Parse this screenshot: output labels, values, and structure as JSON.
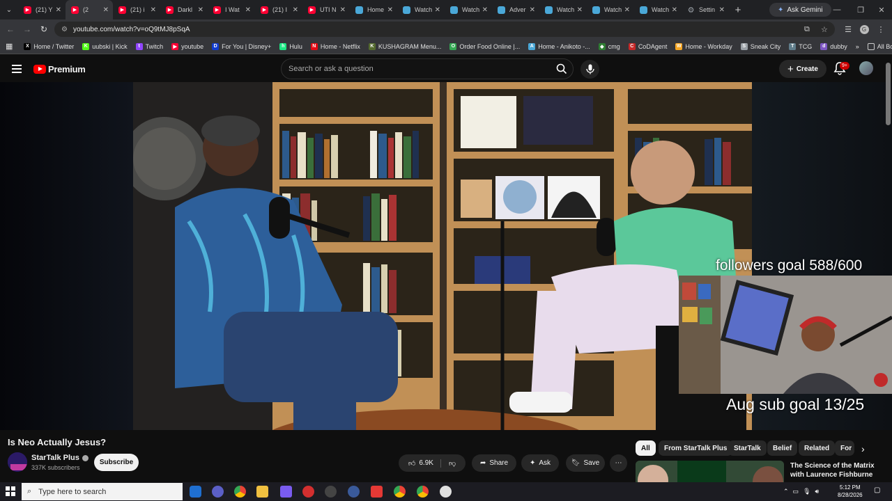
{
  "browser": {
    "tabs": [
      {
        "title": "(21) Y",
        "icon": "youtube-icon",
        "color": "#ff0033"
      },
      {
        "title": "(2",
        "icon": "youtube-icon",
        "color": "#ff0033",
        "active": true
      },
      {
        "title": "(21) i",
        "icon": "youtube-icon",
        "color": "#ff0033"
      },
      {
        "title": "Darkl",
        "icon": "youtube-icon",
        "color": "#ff0033"
      },
      {
        "title": "I Wat",
        "icon": "youtube-icon",
        "color": "#ff0033"
      },
      {
        "title": "(21) I",
        "icon": "youtube-icon",
        "color": "#ff0033"
      },
      {
        "title": "UTI N",
        "icon": "youtube-icon",
        "color": "#ff0033"
      },
      {
        "title": "Home",
        "icon": "globe-icon",
        "color": "#4aa8d8"
      },
      {
        "title": "Watch",
        "icon": "globe-icon",
        "color": "#4aa8d8"
      },
      {
        "title": "Watch",
        "icon": "globe-icon",
        "color": "#4aa8d8"
      },
      {
        "title": "Adver",
        "icon": "globe-icon",
        "color": "#4aa8d8"
      },
      {
        "title": "Watch",
        "icon": "globe-icon",
        "color": "#4aa8d8"
      },
      {
        "title": "Watch",
        "icon": "globe-icon",
        "color": "#4aa8d8"
      },
      {
        "title": "Watch",
        "icon": "globe-icon",
        "color": "#4aa8d8"
      },
      {
        "title": "Settin",
        "icon": "gear-icon",
        "color": "#9aa0a6"
      }
    ],
    "gemini_label": "Ask Gemini",
    "url": "youtube.com/watch?v=oQ9tMJ8pSqA",
    "profile_initial": "G",
    "bookmarks": [
      {
        "label": "Home / Twitter",
        "icon": "x-icon",
        "color": "#000000",
        "glyph": "X"
      },
      {
        "label": "uubski | Kick",
        "icon": "kick-icon",
        "color": "#53fc18",
        "glyph": "K"
      },
      {
        "label": "Twitch",
        "icon": "twitch-icon",
        "color": "#9146ff",
        "glyph": "t"
      },
      {
        "label": "youtube",
        "icon": "youtube-icon",
        "color": "#ff0033",
        "glyph": "▶"
      },
      {
        "label": "For You | Disney+",
        "icon": "disney-icon",
        "color": "#113ccf",
        "glyph": "D"
      },
      {
        "label": "Hulu",
        "icon": "hulu-icon",
        "color": "#1ce783",
        "glyph": "h"
      },
      {
        "label": "Home - Netflix",
        "icon": "netflix-icon",
        "color": "#e50914",
        "glyph": "N"
      },
      {
        "label": "KUSHAGRAM Menu...",
        "icon": "kushagram-icon",
        "color": "#556b2f",
        "glyph": "K"
      },
      {
        "label": "Order Food Online |...",
        "icon": "food-icon",
        "color": "#34a853",
        "glyph": "O"
      },
      {
        "label": "Home - Anikoto -...",
        "icon": "globe-icon",
        "color": "#4aa8d8",
        "glyph": "A"
      },
      {
        "label": "cmg",
        "icon": "cmg-icon",
        "color": "#2e7d32",
        "glyph": "◆"
      },
      {
        "label": "CoDAgent",
        "icon": "codagent-icon",
        "color": "#c62828",
        "glyph": "C"
      },
      {
        "label": "Home - Workday",
        "icon": "workday-icon",
        "color": "#f5a623",
        "glyph": "W"
      },
      {
        "label": "Sneak City",
        "icon": "globe-icon",
        "color": "#9aa0a6",
        "glyph": "S"
      },
      {
        "label": "TCG",
        "icon": "tcg-icon",
        "color": "#607d8b",
        "glyph": "T"
      },
      {
        "label": "dubby",
        "icon": "dubby-icon",
        "color": "#7e57c2",
        "glyph": "d"
      }
    ],
    "all_bookmarks_label": "All Bookmarks"
  },
  "youtube": {
    "logo_text": "Premium",
    "search_placeholder": "Search or ask a question",
    "create_label": "Create",
    "notification_count": "9+"
  },
  "video": {
    "overlay_followers": "followers goal 588/600",
    "overlay_subs": "Aug sub goal 13/25",
    "title": "Is Neo Actually Jesus?",
    "channel": "StarTalk Plus",
    "subscribers": "337K subscribers",
    "subscribe_label": "Subscribe",
    "likes": "6.9K",
    "share_label": "Share",
    "ask_label": "Ask",
    "save_label": "Save"
  },
  "chips": [
    "All",
    "From StarTalk Plus",
    "StarTalk",
    "Belief",
    "Related",
    "For"
  ],
  "recommendation": {
    "title": "The Science of the Matrix with Laurence Fishburne"
  },
  "taskbar": {
    "search_placeholder": "Type here to search",
    "time": "5:12 PM",
    "date": "8/28/2026"
  }
}
